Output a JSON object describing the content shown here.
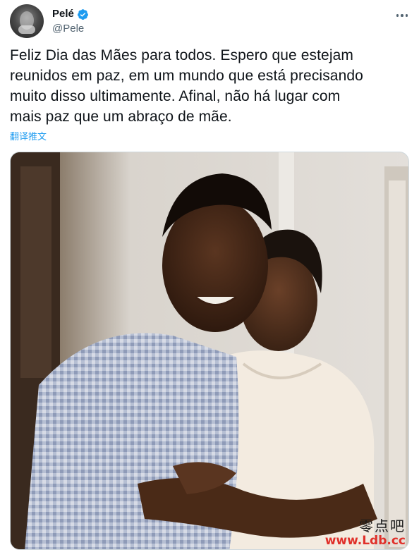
{
  "author": {
    "display_name": "Pelé",
    "handle": "@Pele",
    "verified": true,
    "avatar_icon": "profile-avatar"
  },
  "tweet": {
    "lines": [
      "Feliz Dia das Mães para todos. Espero que estejam",
      "reunidos em paz, em um mundo que está precisando",
      "muito disso ultimamente. Afinal, não há lugar com",
      "mais paz que um abraço de mãe."
    ],
    "translate_label": "翻译推文"
  },
  "media": {
    "kind": "photo",
    "icon": "photo-image"
  },
  "watermark": {
    "site_name": "零点吧",
    "url": "www.Ldb.cc"
  },
  "colors": {
    "link": "#1d9bf0",
    "verified": "#1d9bf0",
    "secondary_text": "#536471",
    "watermark_url": "#e0302a"
  }
}
